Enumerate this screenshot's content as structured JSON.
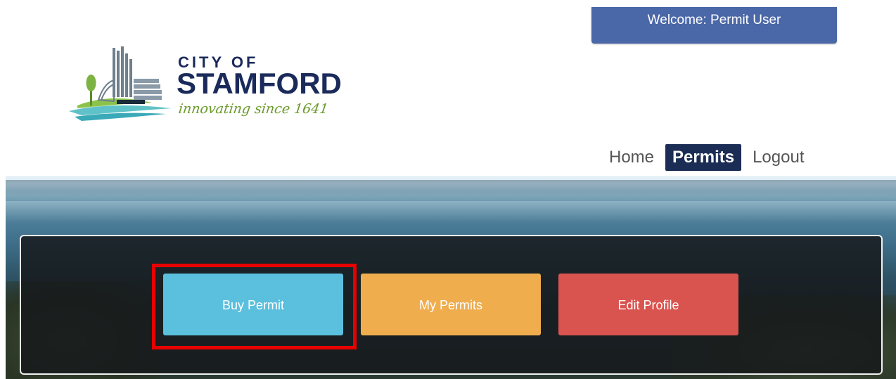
{
  "header": {
    "welcome_text": "Welcome:  Permit User"
  },
  "logo": {
    "line1": "CITY OF",
    "line2": "STAMFORD",
    "tagline": "innovating since 1641"
  },
  "nav": {
    "items": [
      {
        "label": "Home",
        "active": false
      },
      {
        "label": "Permits",
        "active": true
      },
      {
        "label": "Logout",
        "active": false
      }
    ]
  },
  "actions": {
    "buy_permit": "Buy Permit",
    "my_permits": "My Permits",
    "edit_profile": "Edit Profile"
  },
  "colors": {
    "welcome_bg": "#4a67a8",
    "nav_active_bg": "#1b2d55",
    "buy_permit": "#5bc0de",
    "my_permits": "#f0ad4e",
    "edit_profile": "#d9534f",
    "highlight": "#e60000"
  }
}
